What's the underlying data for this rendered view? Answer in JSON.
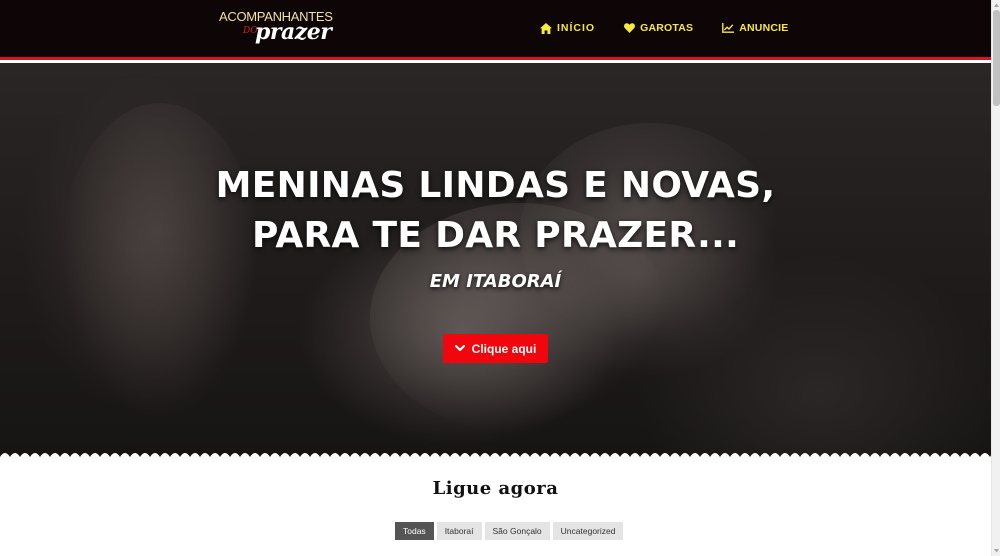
{
  "header": {
    "logo": {
      "top": "ACOMPANHANTES",
      "middle": "DO",
      "bottom": "prazer"
    },
    "nav": [
      {
        "label": "INÍCIO",
        "icon": "home-icon"
      },
      {
        "label": "GAROTAS",
        "icon": "heart-icon"
      },
      {
        "label": "ANUNCIE",
        "icon": "chart-line-icon"
      }
    ]
  },
  "hero": {
    "title_line1": "MENINAS LINDAS E NOVAS,",
    "title_line2": "PARA TE DAR PRAZER...",
    "subtitle": "EM ITABORAÍ",
    "cta_label": "Clique aqui",
    "cta_icon": "chevron-down-icon"
  },
  "content": {
    "section_title": "Ligue agora",
    "filters": [
      {
        "label": "Todas",
        "active": true
      },
      {
        "label": "Itaboraí",
        "active": false
      },
      {
        "label": "São Gonçalo",
        "active": false
      },
      {
        "label": "Uncategorized",
        "active": false
      }
    ]
  },
  "colors": {
    "header_bg": "#0d0506",
    "accent_red": "#f2060d",
    "nav_yellow": "#f6ea3c"
  }
}
